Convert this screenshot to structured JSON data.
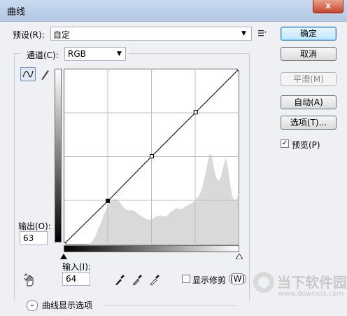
{
  "dialog": {
    "title": "曲线",
    "close_glyph": "x"
  },
  "preset": {
    "label": "预设(R):",
    "value": "自定",
    "menu_icon": "preset-options-icon"
  },
  "channel": {
    "label": "通道(C):",
    "value": "RGB"
  },
  "buttons": {
    "ok": "确定",
    "cancel": "取消",
    "smooth": "平滑(M)",
    "auto": "自动(A)",
    "options": "选项(T)..."
  },
  "preview": {
    "label": "预览(P)",
    "checked": true,
    "mark": "✓"
  },
  "output": {
    "label": "输出(O):",
    "value": "63"
  },
  "input": {
    "label": "输入(I):",
    "value": "64"
  },
  "show_clipping": {
    "label": "显示修剪",
    "shortcut": "(W)",
    "checked": false
  },
  "curve_display": {
    "label": "曲线显示选项",
    "expander_glyph": "⌄"
  },
  "watermark": {
    "text": "当下软件园",
    "url": "www.downxia.com"
  },
  "chart_data": {
    "type": "area",
    "x_range": [
      0,
      255
    ],
    "y_range": [
      0,
      255
    ],
    "grid": true,
    "grid_divisions": 4,
    "curve_points": [
      [
        0,
        0
      ],
      [
        64,
        63
      ],
      [
        128,
        128
      ],
      [
        192,
        192
      ],
      [
        255,
        255
      ]
    ],
    "histogram": [
      0,
      0,
      0,
      0,
      0,
      0,
      0,
      0,
      0,
      0,
      0,
      0,
      2,
      6,
      12,
      20,
      28,
      36,
      45,
      52,
      58,
      62,
      65,
      66,
      64,
      60,
      56,
      52,
      50,
      49,
      50,
      49,
      47,
      44,
      42,
      40,
      38,
      36,
      35,
      36,
      38,
      40,
      41,
      42,
      41,
      40,
      42,
      45,
      48,
      50,
      52,
      52,
      51,
      52,
      55,
      56,
      58,
      60,
      62,
      66,
      70,
      76,
      88,
      102,
      118,
      132,
      128,
      108,
      96,
      92,
      98,
      112,
      126,
      114,
      90,
      70,
      64,
      66,
      74
    ]
  }
}
